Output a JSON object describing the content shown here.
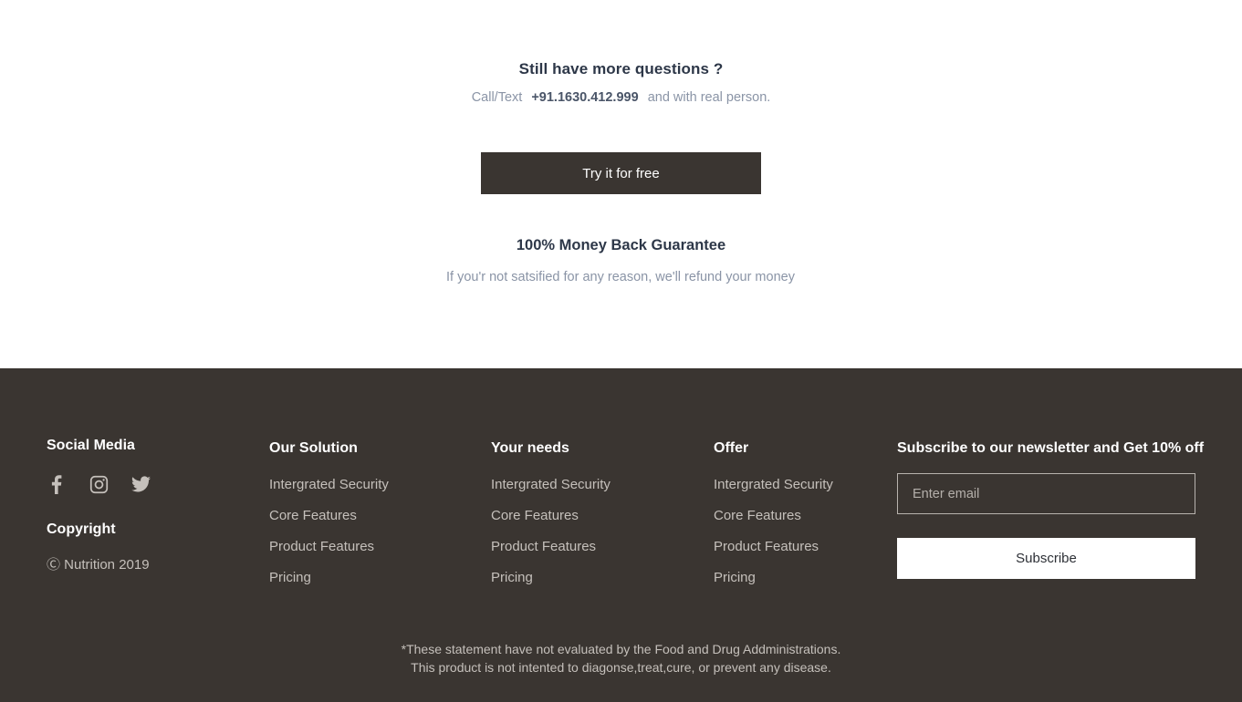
{
  "cta": {
    "heading": "Still have more questions ?",
    "contact_label": "Call/Text",
    "phone": "+91.1630.412.999",
    "contact_suffix": "and with real person.",
    "button_label": "Try it for free",
    "guarantee_title": "100% Money Back Guarantee",
    "guarantee_text": "If you'r not satsified for any reason, we'll refund your money"
  },
  "footer": {
    "social": {
      "heading": "Social Media",
      "icons": [
        {
          "name": "facebook-icon"
        },
        {
          "name": "instagram-icon"
        },
        {
          "name": "twitter-icon"
        }
      ],
      "copyright_heading": "Copyright",
      "copyright_text": "Ⓒ Nutrition 2019"
    },
    "columns": [
      {
        "heading": "Our Solution",
        "links": [
          "Intergrated Security",
          "Core Features",
          "Product Features",
          "Pricing"
        ]
      },
      {
        "heading": "Your needs",
        "links": [
          "Intergrated Security",
          "Core Features",
          "Product Features",
          "Pricing"
        ]
      },
      {
        "heading": "Offer",
        "links": [
          "Intergrated Security",
          "Core Features",
          "Product Features",
          "Pricing"
        ]
      }
    ],
    "newsletter": {
      "heading": "Subscribe to our newsletter and Get 10% off",
      "email_placeholder": "Enter email",
      "email_value": "",
      "button_label": "Subscribe"
    },
    "disclaimer_line1": "*These statement have not evaluated by the Food and Drug Addministrations.",
    "disclaimer_line2": "This product is not intented to diagonse,treat,cure, or prevent any disease."
  },
  "colors": {
    "dark": "#3a3531",
    "heading": "#2d3748",
    "muted": "#8a94a6",
    "footer_link": "#c5c0bb",
    "phone": "#4a5568"
  }
}
